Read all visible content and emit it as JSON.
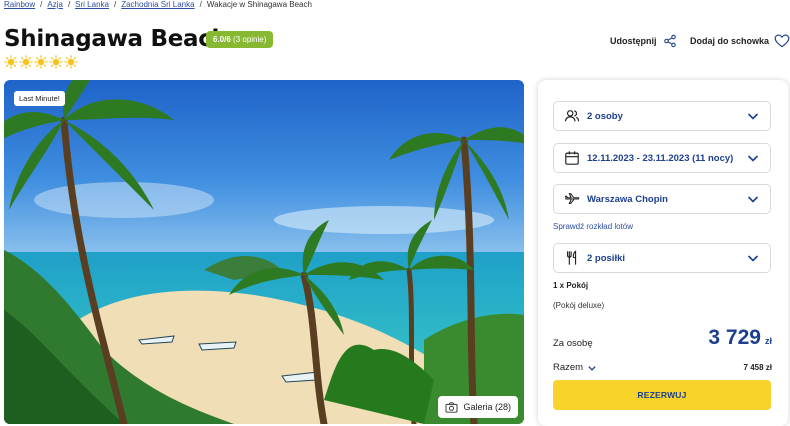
{
  "breadcrumb": {
    "items": [
      "Rainbow",
      "Azja",
      "Sri Lanka",
      "Zachodnia Sri Lanka"
    ],
    "current": "Wakacje w Shinagawa Beach"
  },
  "hotel": {
    "title": "Shinagawa Beach",
    "rating_score": "6.0/6",
    "rating_count": "(3 opinie)",
    "stars": 5
  },
  "actions": {
    "share_label": "Udostępnij",
    "favorite_label": "Dodaj do schowka"
  },
  "gallery": {
    "badge": "Last Minute!",
    "button_label": "Galeria (28)"
  },
  "booking": {
    "travelers": "2 osoby",
    "dates": "12.11.2023 - 23.11.2023 (11 nocy)",
    "departure": "Warszawa Chopin",
    "schedule_link": "Sprawdź rozkład lotów",
    "meals": "2 posiłki",
    "room_count": "1 x Pokój",
    "room_type": "(Pokój deluxe)",
    "per_person_label": "Za osobę",
    "per_person_price": "3 729",
    "currency": "zł",
    "total_label": "Razem",
    "total_value": "7 458 zł",
    "book_label": "REZERWUJ"
  },
  "colors": {
    "brand_blue": "#1d3f8f",
    "rating_green": "#86b832",
    "cta_yellow": "#f8d42a",
    "sun_yellow": "#f7c21a"
  }
}
